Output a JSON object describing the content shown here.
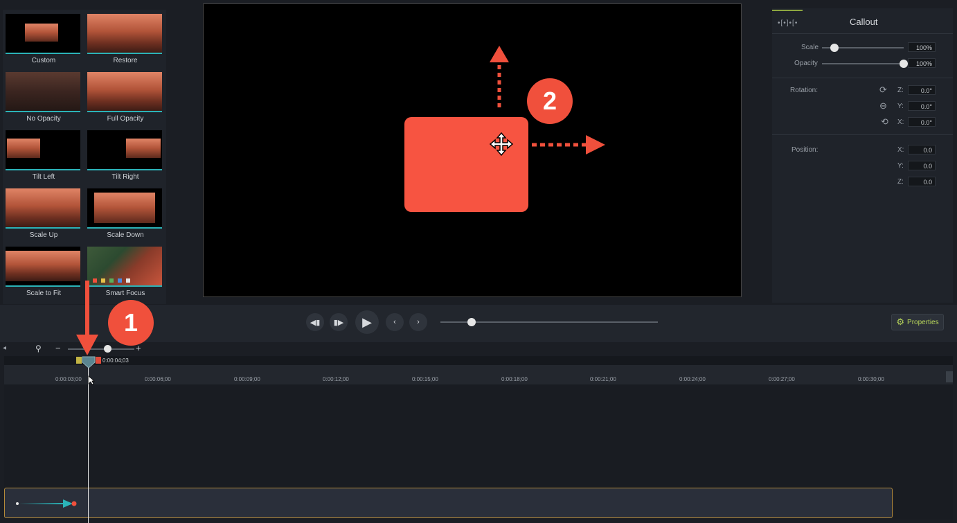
{
  "left_panel": {
    "thumbnails": [
      {
        "label": "Custom"
      },
      {
        "label": "Restore"
      },
      {
        "label": "No Opacity"
      },
      {
        "label": "Full Opacity"
      },
      {
        "label": "Tilt Left"
      },
      {
        "label": "Tilt Right"
      },
      {
        "label": "Scale Up"
      },
      {
        "label": "Scale Down"
      },
      {
        "label": "Scale to Fit"
      },
      {
        "label": "Smart Focus"
      }
    ]
  },
  "properties": {
    "title": "Callout",
    "scale_label": "Scale",
    "scale_value": "100%",
    "scale_level": 0.15,
    "opacity_label": "Opacity",
    "opacity_value": "100%",
    "opacity_level": 1.0,
    "rotation_label": "Rotation:",
    "rotation": {
      "z_label": "Z:",
      "z": "0.0°",
      "y_label": "Y:",
      "y": "0.0°",
      "x_label": "X:",
      "x": "0.0°"
    },
    "position_label": "Position:",
    "position": {
      "x_label": "X:",
      "x": "0.0",
      "y_label": "Y:",
      "y": "0.0",
      "z_label": "Z:",
      "z": "0.0"
    }
  },
  "transport": {
    "properties_button": "Properties"
  },
  "timeline": {
    "playhead_time": "0:00:04;03",
    "ticks": [
      "0:00:03;00",
      "0:00:06;00",
      "0:00:09;00",
      "0:00:12;00",
      "0:00:15;00",
      "0:00:18;00",
      "0:00:21;00",
      "0:00:24;00",
      "0:00:27;00",
      "0:00:30;00"
    ]
  },
  "annotations": {
    "step_1": "1",
    "step_2": "2"
  },
  "colors": {
    "callout_fill": "#f75441",
    "annotation_red": "#f0503c",
    "accent_teal": "#2bb3b8",
    "properties_green": "#b6d45a"
  }
}
